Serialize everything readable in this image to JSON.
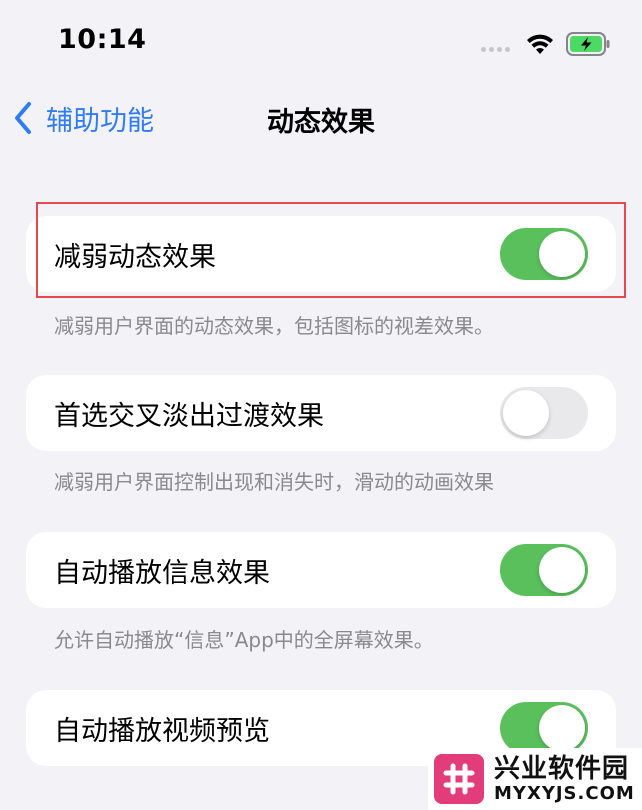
{
  "status_bar": {
    "time": "10:14"
  },
  "nav": {
    "back_label": "辅助功能",
    "title": "动态效果"
  },
  "settings": [
    {
      "label": "减弱动态效果",
      "on": true,
      "footnote": "减弱用户界面的动态效果，包括图标的视差效果。"
    },
    {
      "label": "首选交叉淡出过渡效果",
      "on": false,
      "footnote": "减弱用户界面控制出现和消失时，滑动的动画效果"
    },
    {
      "label": "自动播放信息效果",
      "on": true,
      "footnote": "允许自动播放“信息”App中的全屏幕效果。"
    },
    {
      "label": "自动播放视频预览",
      "on": true
    }
  ],
  "colors": {
    "accent": "#2f7cf6",
    "toggle_on": "#5ac05c",
    "toggle_off": "#e9e9eb",
    "highlight": "#e5484d",
    "watermark_brand": "#e23c7a"
  },
  "watermark": {
    "name": "兴业软件园",
    "domain": "MYXYJS.COM"
  }
}
